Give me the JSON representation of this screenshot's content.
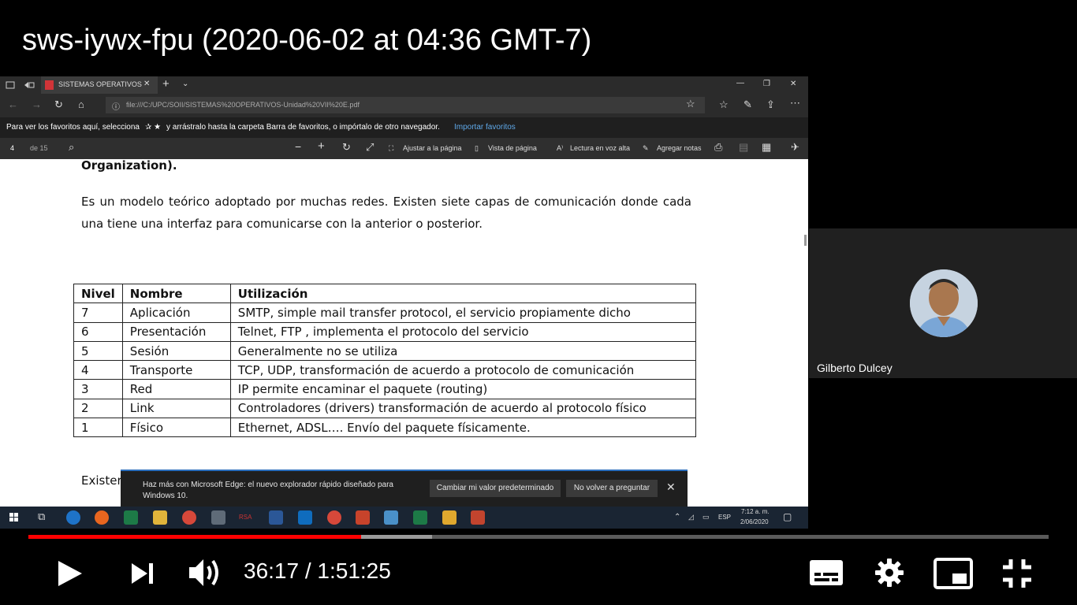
{
  "video": {
    "title": "sws-iywx-fpu (2020-06-02 at 04:36 GMT-7)",
    "progress_fraction": 0.3261,
    "buffered_fraction": 0.3957
  },
  "participant": {
    "name": "Gilberto Dulcey"
  },
  "browser": {
    "tab_title": "SISTEMAS OPERATIVOS",
    "url": "file:///C:/UPC/SOII/SISTEMAS%20OPERATIVOS-Unidad%20VII%20E.pdf",
    "favorites_prompt": "Para ver los favoritos aquí, selecciona",
    "favorites_prompt_2": "y arrástralo hasta la carpeta Barra de favoritos, o impórtalo de otro navegador.",
    "favorites_link": "Importar favoritos"
  },
  "pdf_toolbar": {
    "page_current": "4",
    "page_total": "de 15",
    "fit_page": "Ajustar a la página",
    "page_view": "Vista de página",
    "read_aloud": "Lectura en voz alta",
    "add_notes": "Agregar notas"
  },
  "document": {
    "heading_fragment": "Organization).",
    "paragraph": "Es un modelo teórico adoptado por muchas redes. Existen siete  capas de comunicación donde cada una tiene una interfaz para comunicarse con la anterior o posterior.",
    "table": {
      "headers": [
        "Nivel",
        "Nombre",
        "Utilización"
      ],
      "rows": [
        [
          "7",
          "Aplicación",
          "SMTP, simple mail transfer protocol, el servicio propiamente dicho"
        ],
        [
          "6",
          "Presentación",
          "Telnet, FTP , implementa el protocolo del servicio"
        ],
        [
          "5",
          "Sesión",
          "Generalmente no se utiliza"
        ],
        [
          "4",
          "Transporte",
          "TCP, UDP, transformación de acuerdo a protocolo de comunicación"
        ],
        [
          "3",
          "Red",
          "IP permite encaminar el paquete (routing)"
        ],
        [
          "2",
          "Link",
          "Controladores (drivers) transformación de acuerdo al protocolo físico"
        ],
        [
          "1",
          "Físico",
          "Ethernet, ADSL…. Envío del paquete físicamente."
        ]
      ]
    },
    "bottom_fragment": "Exister"
  },
  "promo": {
    "message": "Haz más con Microsoft Edge: el nuevo explorador rápido diseñado para Windows 10.",
    "btn_default": "Cambiar mi valor predeterminado",
    "btn_dismiss": "No volver a preguntar",
    "close": "✕"
  },
  "taskbar": {
    "lang": "ESP",
    "time": "7:12 a. m.",
    "date": "2/06/2020"
  },
  "player": {
    "time_display": "36:17 / 1:51:25"
  },
  "colors": {
    "progress_played": "#ff0000",
    "edge_accent": "#2a6ebd",
    "link": "#5fa8e8"
  }
}
